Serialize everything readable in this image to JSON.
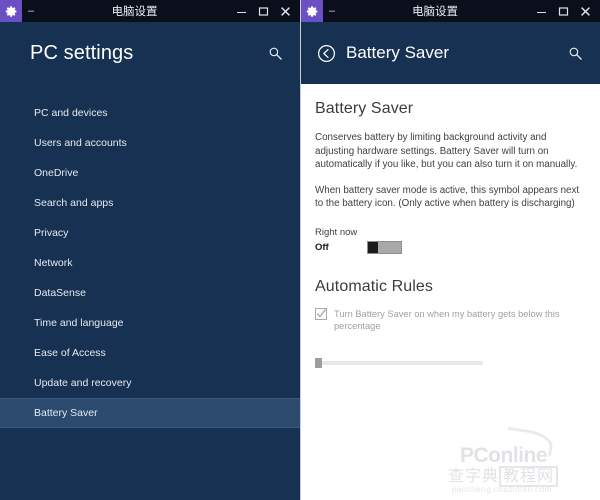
{
  "left_window": {
    "titlebar": {
      "app_icon": "gear-icon",
      "menu_glyph": "–",
      "title": "电脑设置",
      "minimize": "minimize-icon",
      "maximize": "maximize-icon",
      "close": "close-icon"
    },
    "nav": {
      "header_title": "PC settings",
      "search_icon": "search-icon",
      "items": [
        {
          "label": "PC and devices",
          "selected": false
        },
        {
          "label": "Users and accounts",
          "selected": false
        },
        {
          "label": "OneDrive",
          "selected": false
        },
        {
          "label": "Search and apps",
          "selected": false
        },
        {
          "label": "Privacy",
          "selected": false
        },
        {
          "label": "Network",
          "selected": false
        },
        {
          "label": "DataSense",
          "selected": false
        },
        {
          "label": "Time and language",
          "selected": false
        },
        {
          "label": "Ease of Access",
          "selected": false
        },
        {
          "label": "Update and recovery",
          "selected": false
        },
        {
          "label": "Battery Saver",
          "selected": true
        }
      ]
    }
  },
  "right_window": {
    "titlebar": {
      "app_icon": "gear-icon",
      "menu_glyph": "–",
      "title": "电脑设置",
      "minimize": "minimize-icon",
      "maximize": "maximize-icon",
      "close": "close-icon"
    },
    "header": {
      "back_icon": "back-arrow-icon",
      "title": "Battery Saver",
      "search_icon": "search-icon"
    },
    "body": {
      "section_title": "Battery Saver",
      "paragraph_1": "Conserves battery by limiting background activity and adjusting hardware settings. Battery Saver will turn on automatically if you like, but you can also turn it on manually.",
      "paragraph_2": "When battery saver mode is active, this symbol appears next to the battery icon. (Only active when battery is discharging)",
      "right_now_label": "Right now",
      "toggle_state": "Off",
      "toggle_on": false,
      "rules_title": "Automatic Rules",
      "rule_checkbox_label": "Turn Battery Saver on when my battery gets below this percentage",
      "rule_checkbox_checked": true,
      "rule_checkbox_disabled": true,
      "slider_value_pct": 0
    }
  },
  "watermark": {
    "brand": "PConline",
    "chinese_1": "查字典",
    "chinese_2": "教程网",
    "url": "jiaocheng.chazidian.com"
  },
  "colors": {
    "titlebar_bg": "#0b0f1c",
    "app_icon_bg": "#6b4fc4",
    "nav_bg": "#173152",
    "nav_selected_bg": "#2b4a6e",
    "content_bg": "#ffffff",
    "text_light": "#e5e9ef",
    "text_dark": "#3f3f3f",
    "disabled_text": "#a0a0a0"
  }
}
